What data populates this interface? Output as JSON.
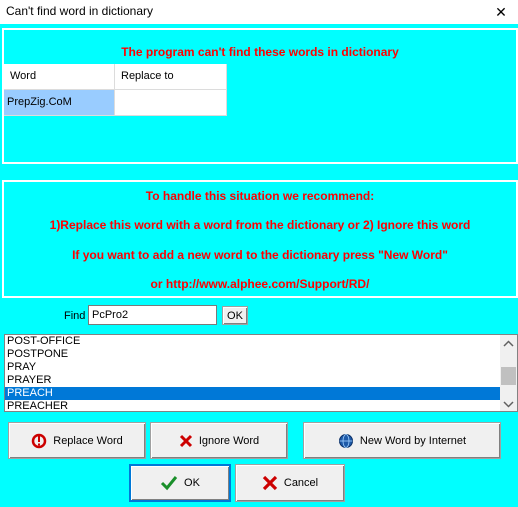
{
  "window": {
    "title": "Can't find word in dictionary",
    "close_glyph": "✕"
  },
  "top_panel": {
    "heading": "The program can't find these words in dictionary",
    "columns": [
      "Word",
      "Replace to"
    ],
    "rows": [
      {
        "word": "PrepZig.CoM",
        "replace": ""
      }
    ]
  },
  "info_panel": {
    "line1": "To handle this situation we recommend:",
    "line2": "1)Replace this word with a word from the dictionary or  2) Ignore this word",
    "line3": "If you want to add a new word to the dictionary press \"New Word\"",
    "line4": "or http://www.alphee.com/Support/RD/"
  },
  "find": {
    "label": "Find",
    "value": "PcPro2",
    "ok_label": "OK"
  },
  "word_list": {
    "items": [
      "POST-OFFICE",
      "POSTPONE",
      "PRAY",
      "PRAYER",
      "PREACH",
      "PREACHER"
    ],
    "selected": "PREACH"
  },
  "buttons": {
    "replace_word": "Replace Word",
    "ignore_word": "Ignore Word",
    "new_word": "New Word by Internet",
    "ok": "OK",
    "cancel": "Cancel"
  },
  "colors": {
    "background": "#00ffff",
    "alert_text": "#ff0000",
    "selection": "#0078d7",
    "cell_highlight": "#99ccff"
  }
}
